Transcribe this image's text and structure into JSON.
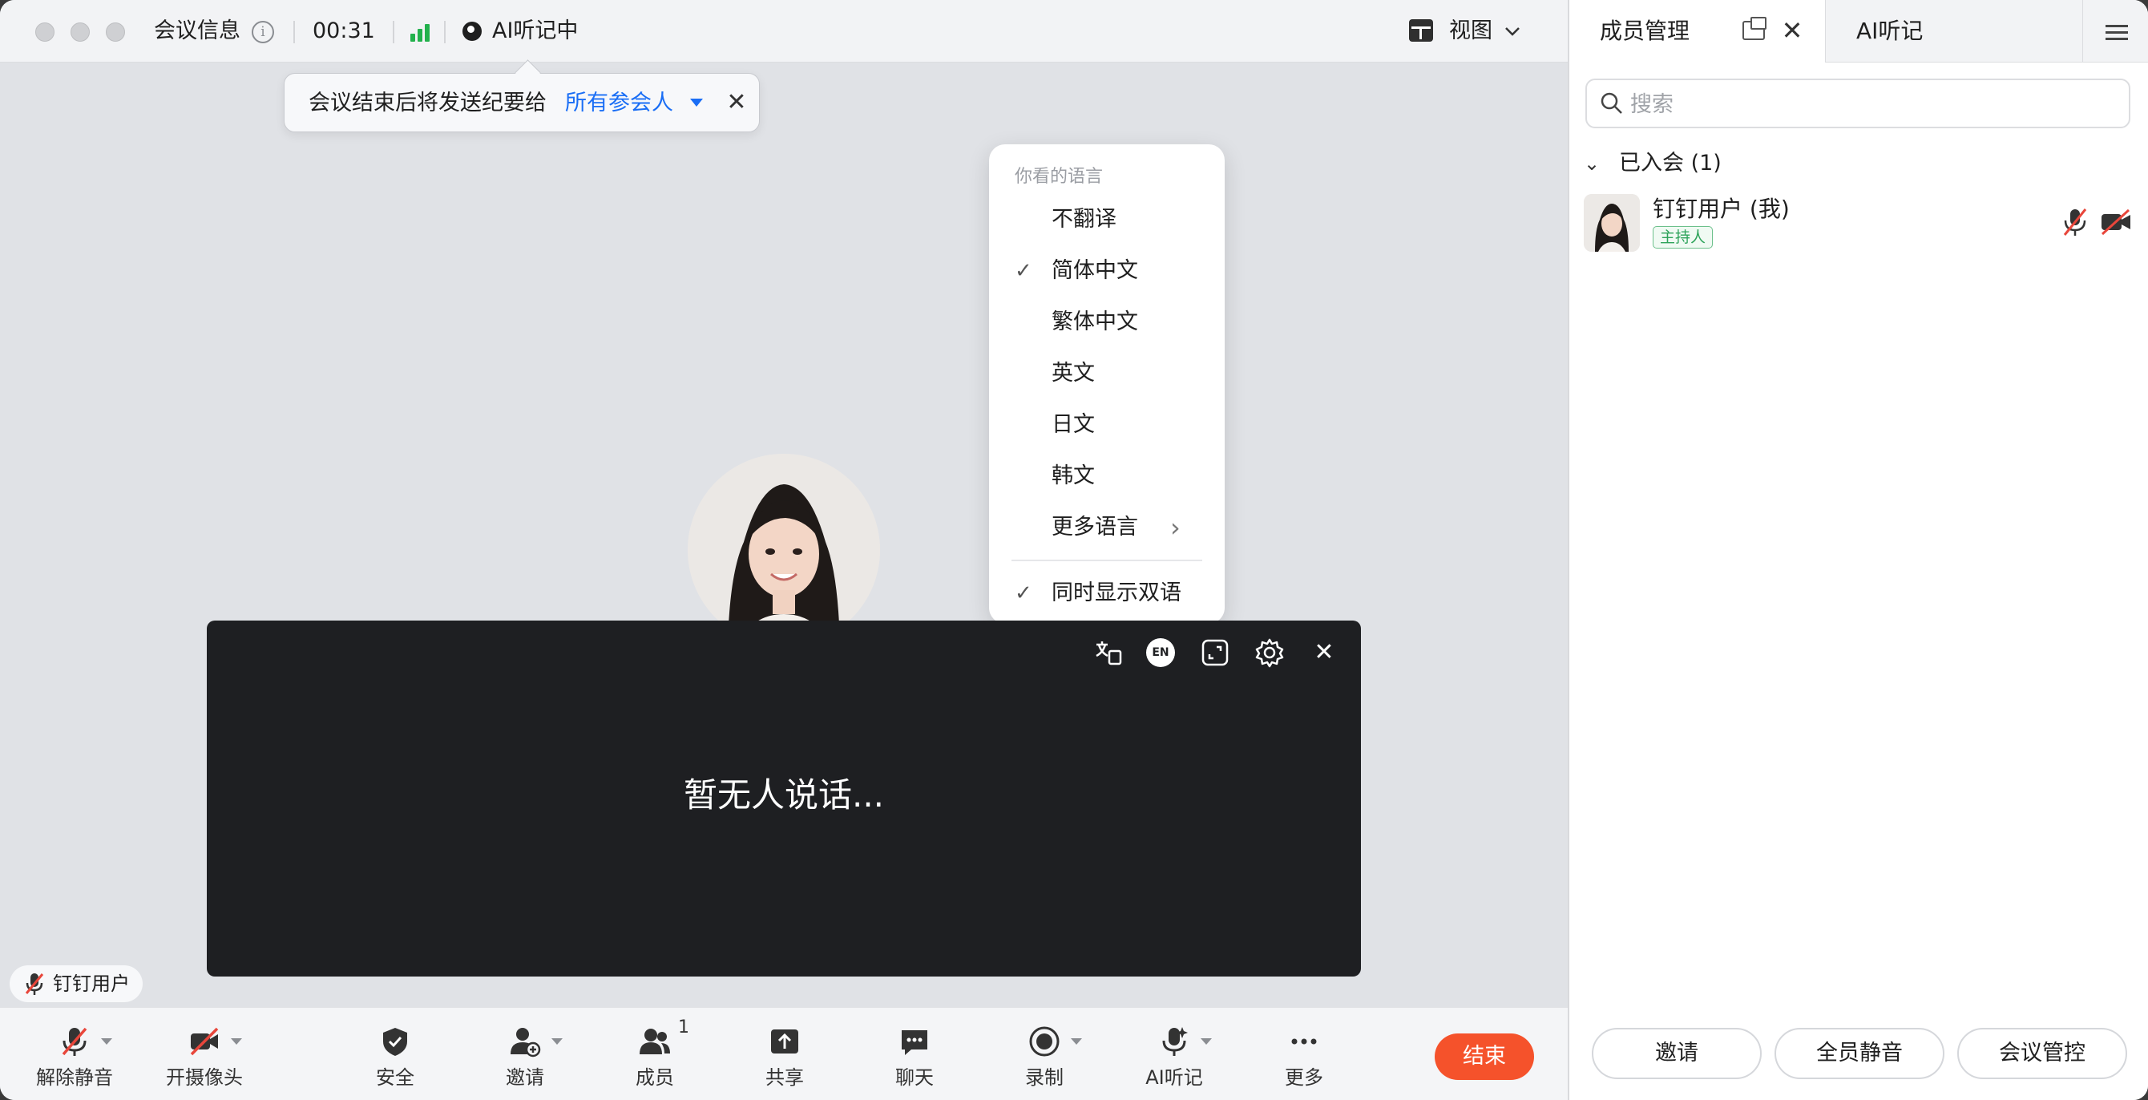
{
  "titlebar": {
    "meeting_info": "会议信息",
    "timer": "00:31",
    "ai_status": "AI听记中",
    "view_label": "视图"
  },
  "summary_tip": {
    "text": "会议结束后将发送纪要给",
    "recipient": "所有参会人"
  },
  "language_menu": {
    "header": "你看的语言",
    "items": [
      {
        "label": "不翻译",
        "checked": false
      },
      {
        "label": "简体中文",
        "checked": true
      },
      {
        "label": "繁体中文",
        "checked": false
      },
      {
        "label": "英文",
        "checked": false
      },
      {
        "label": "日文",
        "checked": false
      },
      {
        "label": "韩文",
        "checked": false
      },
      {
        "label": "更多语言",
        "checked": false,
        "submenu": true
      }
    ],
    "bilingual": {
      "label": "同时显示双语",
      "checked": true
    }
  },
  "caption": {
    "text": "暂无人说话...",
    "lang_badge": "EN"
  },
  "name_tag": {
    "label": "钉钉用户"
  },
  "toolbar": {
    "items": [
      {
        "label": "解除静音",
        "icon": "mic-off-icon"
      },
      {
        "label": "开摄像头",
        "icon": "camera-off-icon"
      },
      {
        "label": "安全",
        "icon": "shield-icon"
      },
      {
        "label": "邀请",
        "icon": "add-user-icon"
      },
      {
        "label": "成员",
        "icon": "members-icon",
        "badge": "1"
      },
      {
        "label": "共享",
        "icon": "share-icon"
      },
      {
        "label": "聊天",
        "icon": "chat-icon"
      },
      {
        "label": "录制",
        "icon": "record-icon"
      },
      {
        "label": "AI听记",
        "icon": "ai-notes-icon"
      },
      {
        "label": "更多",
        "icon": "more-icon"
      }
    ],
    "end_label": "结束"
  },
  "side_panel": {
    "tab_members": "成员管理",
    "tab_ai": "AI听记",
    "search_placeholder": "搜索",
    "group_label": "已入会 (1)",
    "member": {
      "name": "钉钉用户 (我)",
      "role": "主持人"
    },
    "buttons": {
      "invite": "邀请",
      "mute_all": "全员静音",
      "controls": "会议管控"
    }
  },
  "colors": {
    "accent_link": "#1a6ef5",
    "end_button": "#f5522b",
    "signal": "#22b14c",
    "host_badge": "#2ea35a",
    "muted_red": "#e8463b"
  }
}
